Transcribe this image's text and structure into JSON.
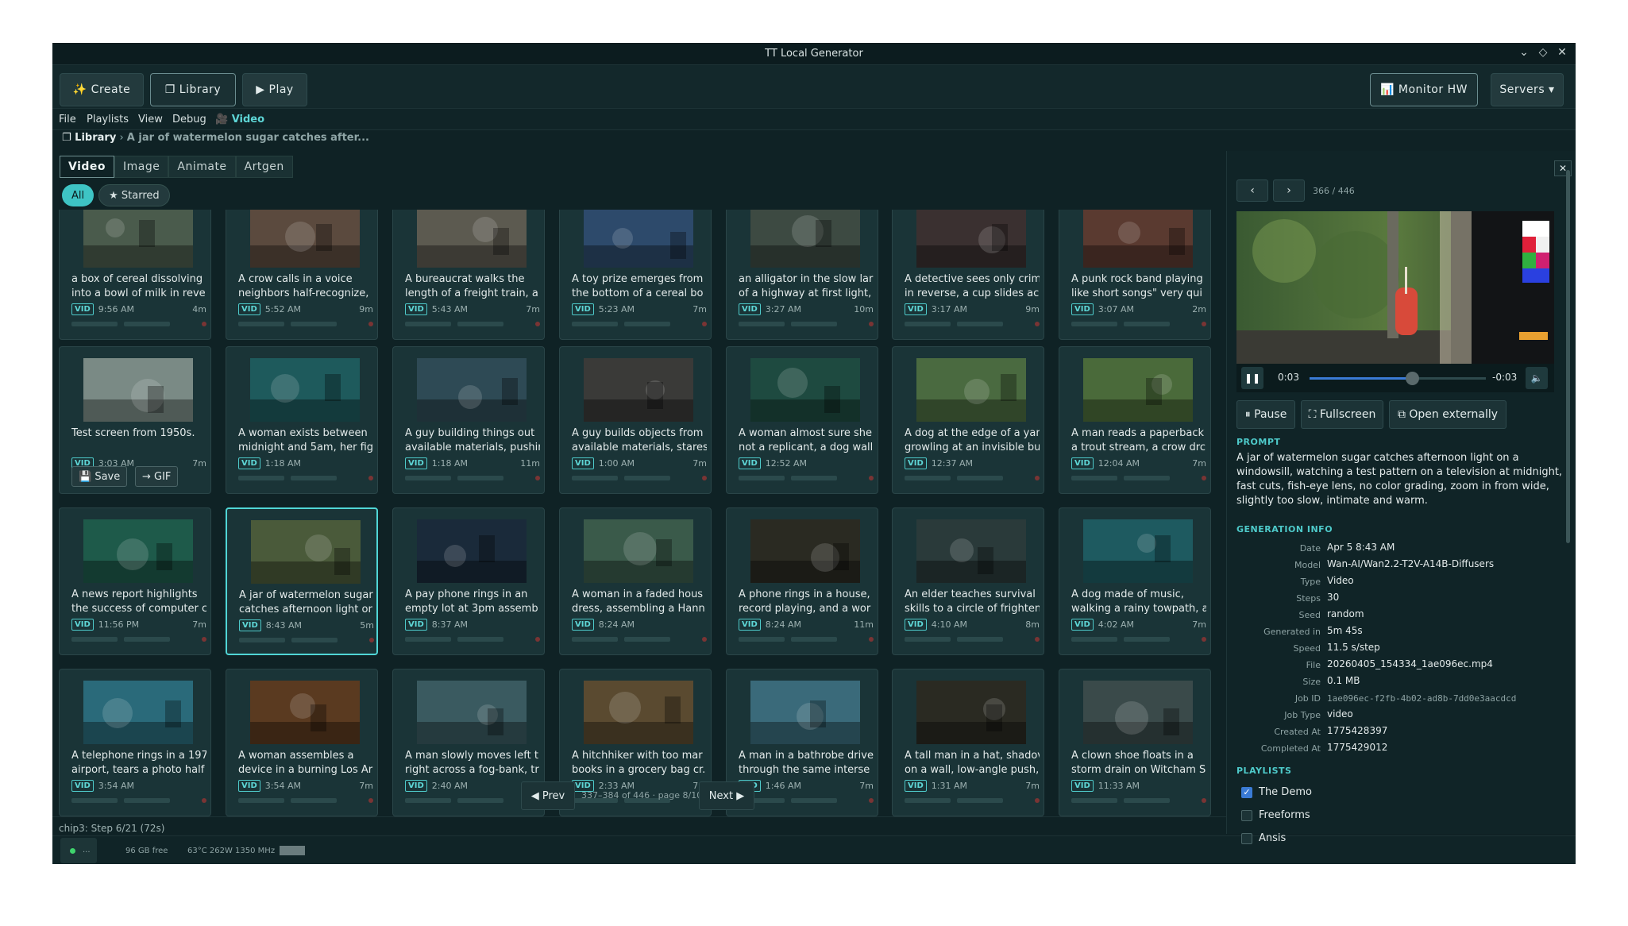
{
  "window": {
    "title": "TT Local Generator"
  },
  "toolbar": {
    "create": "✨ Create",
    "library": "❐ Library",
    "play": "▶ Play",
    "monitor": "📊 Monitor HW",
    "servers": "Servers ▾"
  },
  "menu": {
    "file": "File",
    "playlists": "Playlists",
    "view": "View",
    "debug": "Debug",
    "video": "🎥 Video"
  },
  "breadcrumb": {
    "root": "❐ Library",
    "sep": "›",
    "current": "A jar of watermelon sugar catches after..."
  },
  "tabs": [
    "Video",
    "Image",
    "Animate",
    "Artgen"
  ],
  "filters": {
    "all": "All",
    "starred": "★ Starred"
  },
  "badge": "VID",
  "cards": [
    {
      "c1": "a box of cereal dissolving",
      "c2": "into a bowl of milk in reve",
      "time": "9:56 AM",
      "dur": "4m",
      "color": "#4a5b4c"
    },
    {
      "c1": "A crow calls in a voice",
      "c2": "neighbors half-recognize,",
      "time": "5:52 AM",
      "dur": "9m",
      "color": "#5b4a3e"
    },
    {
      "c1": "A bureaucrat walks the",
      "c2": "length of a freight train, a",
      "time": "5:43 AM",
      "dur": "7m",
      "color": "#5c5a50"
    },
    {
      "c1": "A toy prize emerges from",
      "c2": "the bottom of a cereal bo",
      "time": "5:23 AM",
      "dur": "7m",
      "color": "#2d4a6b"
    },
    {
      "c1": "an alligator in the slow lar",
      "c2": "of a highway at first light,",
      "time": "3:27 AM",
      "dur": "10m",
      "color": "#3d4a42"
    },
    {
      "c1": "A detective sees only crim",
      "c2": "in reverse, a cup slides acr",
      "time": "3:17 AM",
      "dur": "9m",
      "color": "#3a3030"
    },
    {
      "c1": "A punk rock band playing",
      "c2": "like short songs\" very qui",
      "time": "3:07 AM",
      "dur": "2m",
      "color": "#5a3a30"
    },
    {
      "c1": "Test screen from 1950s.",
      "c2": "",
      "time": "3:03 AM",
      "dur": "7m",
      "color": "#7a8a85"
    },
    {
      "c1": "A woman exists between",
      "c2": "midnight and 5am, her fig",
      "time": "1:18 AM",
      "dur": "",
      "color": "#1e5a5c"
    },
    {
      "c1": "A guy building things out",
      "c2": "available materials, pushir",
      "time": "1:18 AM",
      "dur": "11m",
      "color": "#2e4a55"
    },
    {
      "c1": "A guy builds objects from",
      "c2": "available materials, stares",
      "time": "1:00 AM",
      "dur": "7m",
      "color": "#3a3a38"
    },
    {
      "c1": "A woman almost sure she",
      "c2": "not a replicant, a dog wall",
      "time": "12:52 AM",
      "dur": "",
      "color": "#1e4a40"
    },
    {
      "c1": "A dog at the edge of a yar",
      "c2": "growling at an invisible bu",
      "time": "12:37 AM",
      "dur": "",
      "color": "#4a6a40"
    },
    {
      "c1": "A man reads a paperback",
      "c2": "a trout stream, a crow drc",
      "time": "12:04 AM",
      "dur": "7m",
      "color": "#4a6a3a"
    },
    {
      "c1": "A news report highlights",
      "c2": "the success of computer c",
      "time": "11:56 PM",
      "dur": "7m",
      "color": "#1e5a4a"
    },
    {
      "c1": "A jar of watermelon sugar",
      "c2": "catches afternoon light or",
      "time": "8:43 AM",
      "dur": "5m",
      "color": "#4a5a3a"
    },
    {
      "c1": "A pay phone rings in an",
      "c2": "empty lot at 3pm assemb",
      "time": "8:37 AM",
      "dur": "",
      "color": "#1a2a3a"
    },
    {
      "c1": "A woman in a faded hous",
      "c2": "dress, assembling a Hann",
      "time": "8:24 AM",
      "dur": "",
      "color": "#3a5a4a"
    },
    {
      "c1": "A phone rings in a house,",
      "c2": "record playing, and a wor",
      "time": "8:24 AM",
      "dur": "11m",
      "color": "#2a2a22"
    },
    {
      "c1": "An elder teaches survival",
      "c2": "skills to a circle of frighten",
      "time": "4:10 AM",
      "dur": "8m",
      "color": "#2a3a3a"
    },
    {
      "c1": "A dog made of music,",
      "c2": "walking a rainy towpath, a",
      "time": "4:02 AM",
      "dur": "7m",
      "color": "#1e5a60"
    },
    {
      "c1": "A telephone rings in a 197",
      "c2": "airport, tears a photo half",
      "time": "3:54 AM",
      "dur": "",
      "color": "#2a6a7a"
    },
    {
      "c1": "A woman assembles a",
      "c2": "device in a burning Los Ar",
      "time": "3:54 AM",
      "dur": "7m",
      "color": "#5a3a20"
    },
    {
      "c1": "A man slowly moves left t",
      "c2": "right across a fog-bank, tr",
      "time": "2:40 AM",
      "dur": "7m",
      "color": "#3a5a60"
    },
    {
      "c1": "A hitchhiker with too mar",
      "c2": "books in a grocery bag cr.",
      "time": "2:33 AM",
      "dur": "7m",
      "color": "#5a4a30"
    },
    {
      "c1": "A man in a bathrobe drive",
      "c2": "through the same interse",
      "time": "1:46 AM",
      "dur": "7m",
      "color": "#3a6a7a"
    },
    {
      "c1": "A tall man in a hat, shadov",
      "c2": "on a wall, low-angle push,",
      "time": "1:31 AM",
      "dur": "7m",
      "color": "#2a2a22"
    },
    {
      "c1": "A clown shoe floats in a",
      "c2": "storm drain on Witcham S",
      "time": "11:33 AM",
      "dur": "",
      "color": "#3a4a4a"
    }
  ],
  "hover_actions": {
    "save": "💾 Save",
    "gif": "→ GIF"
  },
  "pager": {
    "prev": "◀ Prev",
    "info": "337–384 of 446 · page 8/10",
    "next": "Next ▶"
  },
  "status": {
    "line": "chip3: Step 6/21 (72s)",
    "disk": "96 GB free",
    "hw": "63°C 262W 1350 MHz",
    "dots": "..."
  },
  "panel": {
    "close": "✕",
    "prev": "‹",
    "next": "›",
    "count": "366 / 446",
    "player": {
      "current": "0:03",
      "remaining": "-0:03",
      "progress": 0.58
    },
    "buttons": {
      "pause": "⏸ Pause",
      "fullscreen": "⛶ Fullscreen",
      "open": "⧉ Open externally"
    },
    "prompt_label": "PROMPT",
    "prompt": "A jar of watermelon sugar catches afternoon light on a windowsill, watching a test pattern on a television at midnight, fast cuts, fish-eye lens, no color grading, zoom in from wide, slightly too slow, intimate and warm.",
    "gen_label": "GENERATION INFO",
    "info": [
      {
        "k": "Date",
        "v": "Apr 5  8:43 AM"
      },
      {
        "k": "Model",
        "v": "Wan-AI/Wan2.2-T2V-A14B-Diffusers"
      },
      {
        "k": "Type",
        "v": "Video"
      },
      {
        "k": "Steps",
        "v": "30"
      },
      {
        "k": "Seed",
        "v": "random"
      },
      {
        "k": "Generated in",
        "v": "5m 45s"
      },
      {
        "k": "Speed",
        "v": "11.5 s/step"
      },
      {
        "k": "File",
        "v": "20260405_154334_1ae096ec.mp4"
      },
      {
        "k": "Size",
        "v": "0.1 MB"
      },
      {
        "k": "Job ID",
        "v": "1ae096ec-f2fb-4b02-ad8b-7dd0e3aacdcd"
      },
      {
        "k": "Job Type",
        "v": "video"
      },
      {
        "k": "Created At",
        "v": "1775428397"
      },
      {
        "k": "Completed At",
        "v": "1775429012"
      }
    ],
    "playlists_label": "PLAYLISTS",
    "playlists": [
      {
        "name": "The Demo",
        "checked": true
      },
      {
        "name": "Freeforms",
        "checked": false
      },
      {
        "name": "Ansis",
        "checked": false
      }
    ]
  }
}
